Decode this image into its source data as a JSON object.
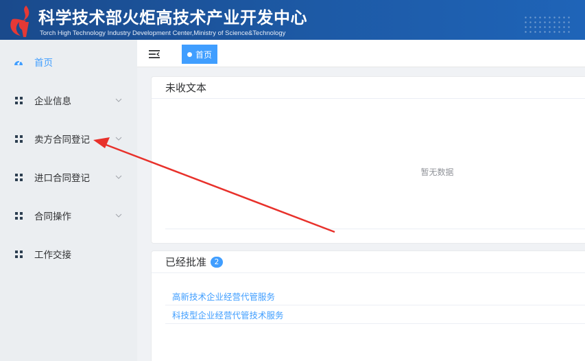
{
  "header": {
    "title_cn": "科学技术部火炬高技术产业开发中心",
    "title_en": "Torch High Technology Industry Development Center,Ministry of Science&Technology",
    "logo_icon": "torch-logo-icon"
  },
  "sidebar": {
    "items": [
      {
        "label": "首页",
        "icon": "dashboard-icon",
        "active": true
      },
      {
        "label": "企业信息",
        "icon": "grid-icon",
        "has_children": true
      },
      {
        "label": "卖方合同登记",
        "icon": "grid-icon",
        "has_children": true
      },
      {
        "label": "进口合同登记",
        "icon": "grid-icon",
        "has_children": true
      },
      {
        "label": "合同操作",
        "icon": "grid-icon",
        "has_children": true
      },
      {
        "label": "工作交接",
        "icon": "grid-icon",
        "has_children": false
      }
    ]
  },
  "topbar": {
    "tabs": [
      {
        "label": "首页",
        "active": true
      }
    ]
  },
  "cards": {
    "unreceived": {
      "title": "未收文本",
      "empty_text": "暂无数据"
    },
    "approved": {
      "title": "已经批准",
      "count": "2",
      "items": [
        "高新技术企业经营代管服务",
        "科技型企业经营代管技术服务"
      ]
    }
  },
  "colors": {
    "accent": "#409eff",
    "header_bg": "#1d5aa6",
    "sidebar_bg": "#ebeef1",
    "annotation_arrow": "#e8312b"
  }
}
